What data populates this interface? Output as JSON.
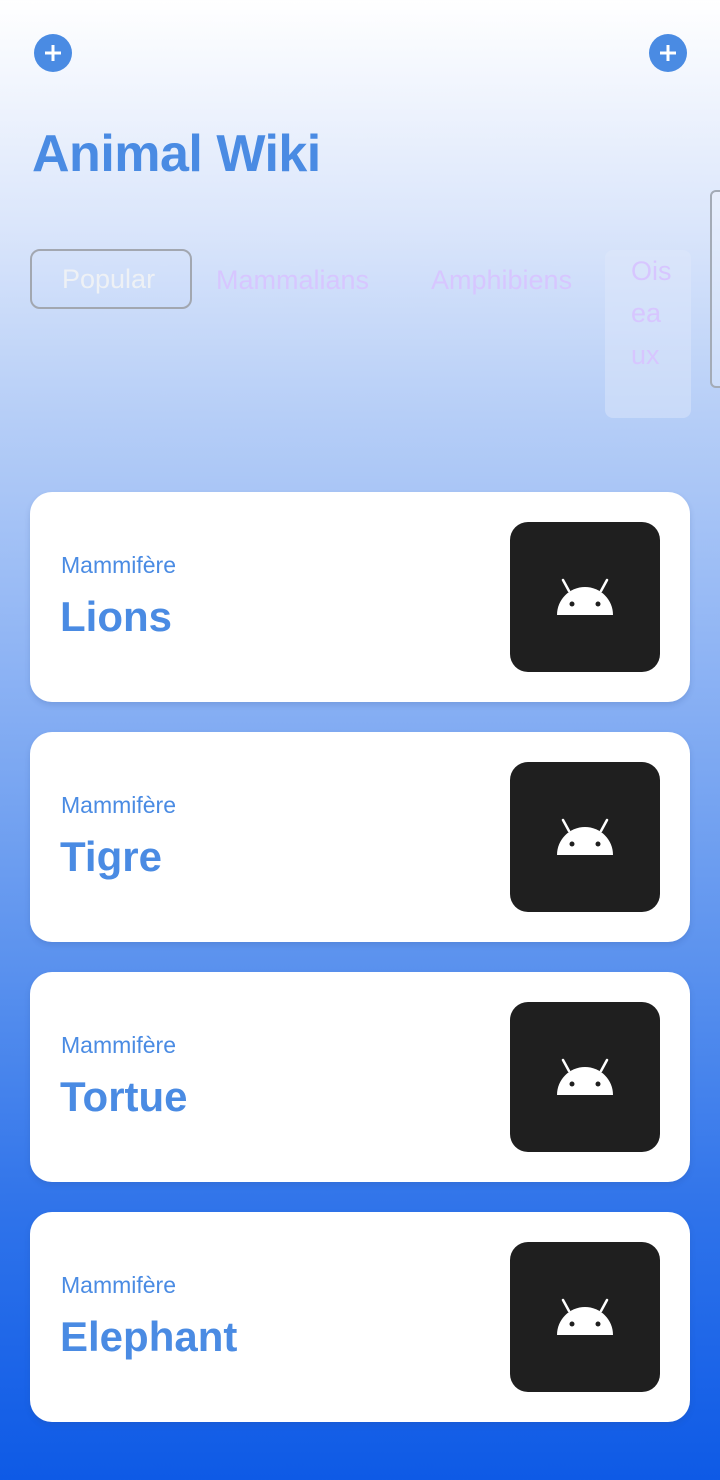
{
  "app": {
    "title": "Animal Wiki"
  },
  "header": {
    "left_action": "add",
    "right_action": "add"
  },
  "filters": [
    {
      "label": "Popular",
      "selected": true
    },
    {
      "label": "Mammalians",
      "selected": false
    },
    {
      "label": "Amphibiens",
      "selected": false
    },
    {
      "label": "Oiseaux",
      "selected": false
    }
  ],
  "animals": [
    {
      "category": "Mammifère",
      "name": "Lions",
      "icon": "android-icon"
    },
    {
      "category": "Mammifère",
      "name": "Tigre",
      "icon": "android-icon"
    },
    {
      "category": "Mammifère",
      "name": "Tortue",
      "icon": "android-icon"
    },
    {
      "category": "Mammifère",
      "name": "Elephant",
      "icon": "android-icon"
    }
  ],
  "colors": {
    "accent": "#4a8be3",
    "chip_text": "#d7c6ff",
    "thumb_bg": "#1f1f1f",
    "gradient_bottom": "#0e5ae6"
  }
}
